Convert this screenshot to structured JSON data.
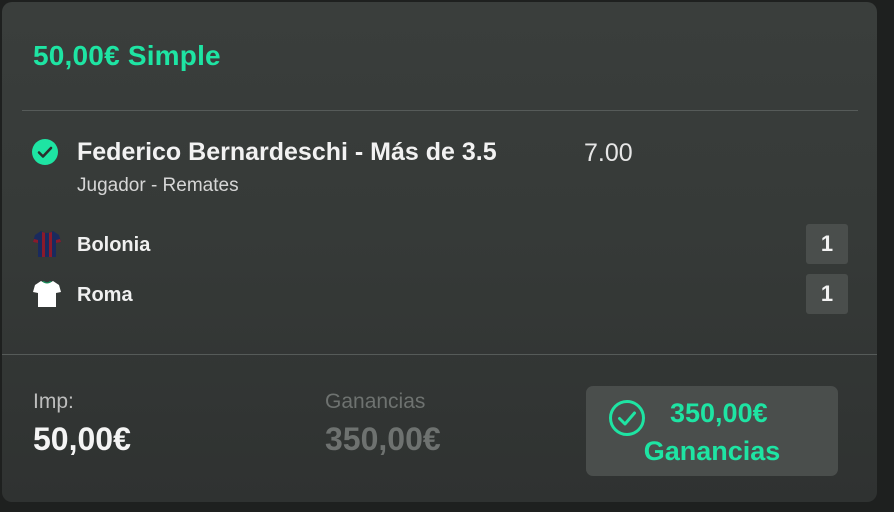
{
  "bet": {
    "title": "50,00€ Simple"
  },
  "selection": {
    "name": "Federico Bernardeschi - Más de 3.5",
    "odds": "7.00",
    "market": "Jugador - Remates",
    "status_icon": "check-circle-icon"
  },
  "teams": {
    "home": {
      "name": "Bolonia",
      "score": "1",
      "jersey_icon": "jersey-icon",
      "jersey_colors": [
        "#1a2a5e",
        "#8b1a2a"
      ]
    },
    "away": {
      "name": "Roma",
      "score": "1",
      "jersey_icon": "jersey-icon",
      "jersey_colors": [
        "#ffffff",
        "#1a8a5a"
      ]
    }
  },
  "summary": {
    "stake_label": "Imp:",
    "stake_value": "50,00€",
    "returns_label": "Ganancias",
    "returns_value": "350,00€",
    "won_amount": "350,00€",
    "won_label": "Ganancias",
    "won_icon": "check-circle-outline-icon"
  },
  "colors": {
    "accent": "#1ee4a3",
    "card_background": "#383c3a",
    "score_box": "#4a4e4c",
    "muted_text": "#6e7270"
  }
}
